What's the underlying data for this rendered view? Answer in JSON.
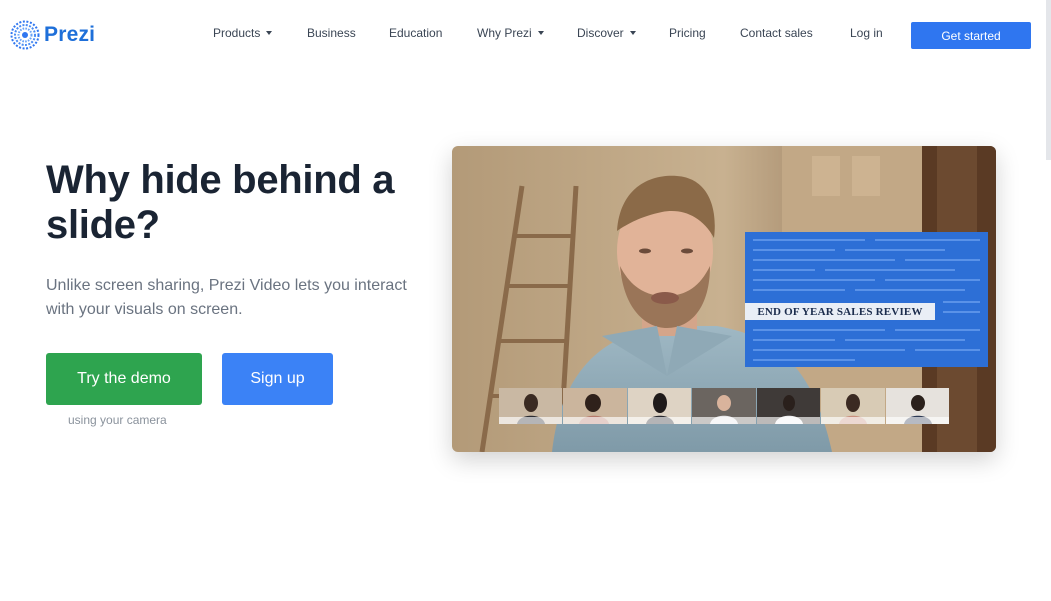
{
  "header": {
    "logo_text": "Prezi",
    "nav": [
      {
        "label": "Products",
        "has_dropdown": true
      },
      {
        "label": "Business",
        "has_dropdown": false
      },
      {
        "label": "Education",
        "has_dropdown": false
      },
      {
        "label": "Why Prezi",
        "has_dropdown": true
      },
      {
        "label": "Discover",
        "has_dropdown": true
      },
      {
        "label": "Pricing",
        "has_dropdown": false
      },
      {
        "label": "Contact sales",
        "has_dropdown": false
      },
      {
        "label": "Log in",
        "has_dropdown": false
      }
    ],
    "cta_label": "Get started"
  },
  "hero": {
    "headline": "Why hide behind a slide?",
    "subtext": "Unlike screen sharing, Prezi Video lets you interact with your visuals on screen.",
    "demo_button": "Try the demo",
    "signup_button": "Sign up",
    "demo_note": "using your camera"
  },
  "video": {
    "slide_title": "END OF YEAR SALES REVIEW",
    "participant_count": 7
  },
  "colors": {
    "brand_blue": "#2f76f0",
    "demo_green": "#2ea44f",
    "signup_blue": "#3b82f6",
    "slide_blue": "#2d6fd6"
  },
  "icons": {
    "logo": "prezi-logo-icon",
    "dropdown": "chevron-down-icon"
  }
}
